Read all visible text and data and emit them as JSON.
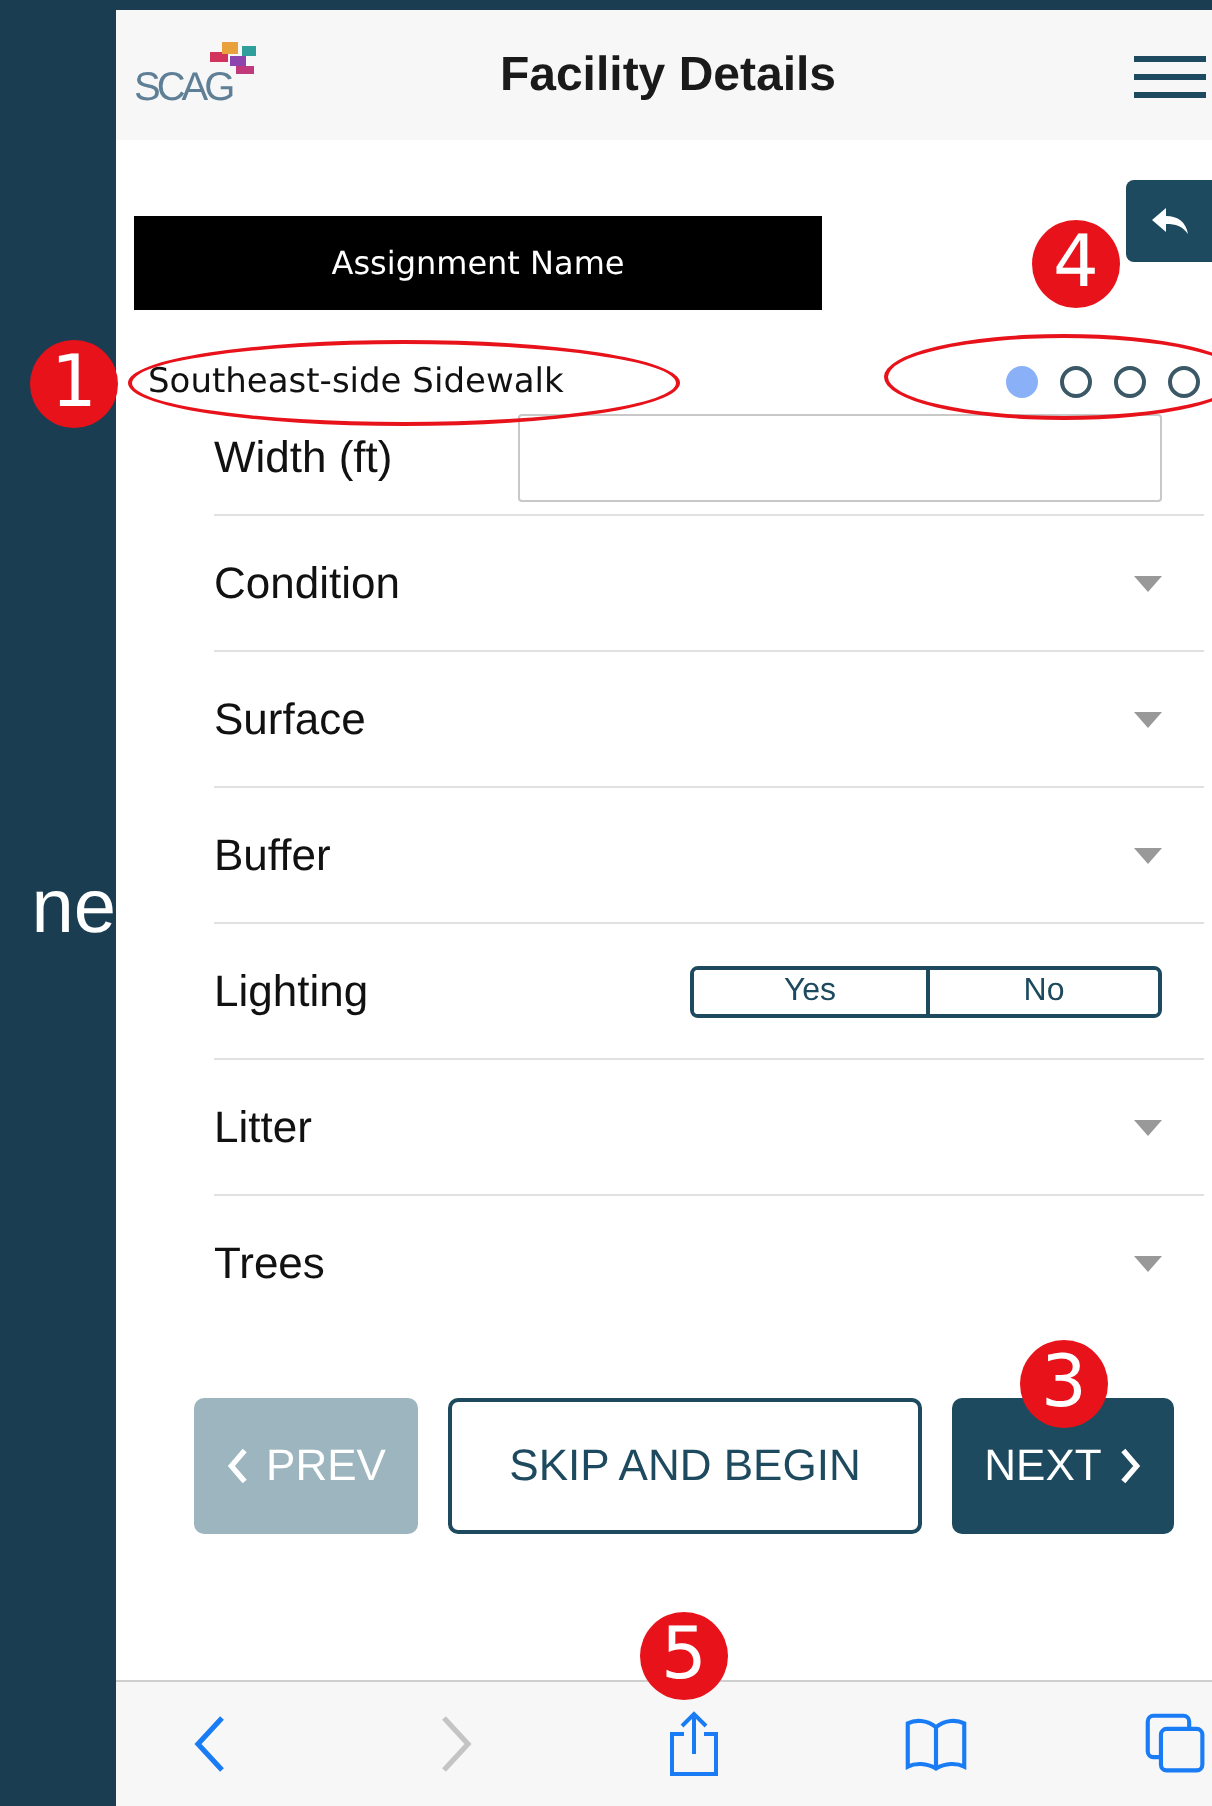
{
  "side_text": "ne",
  "header": {
    "logo": "SCAG",
    "title": "Facility Details"
  },
  "assignment_label": "Assignment Name",
  "facility_name": "Southeast-side Sidewalk",
  "page_dots": [
    {
      "selected": true
    },
    {
      "selected": false
    },
    {
      "selected": false
    },
    {
      "selected": false
    }
  ],
  "fields": [
    {
      "kind": "input",
      "label": "Width (ft)"
    },
    {
      "kind": "dropdown",
      "label": "Condition"
    },
    {
      "kind": "dropdown",
      "label": "Surface"
    },
    {
      "kind": "dropdown",
      "label": "Buffer"
    },
    {
      "kind": "toggle",
      "label": "Lighting",
      "options": [
        {
          "label": "Yes",
          "selected": false
        },
        {
          "label": "No",
          "selected": false
        }
      ]
    },
    {
      "kind": "dropdown",
      "label": "Litter"
    },
    {
      "kind": "dropdown",
      "label": "Trees"
    }
  ],
  "buttons": [
    {
      "kind": "prev",
      "label": "PREV",
      "disabled": true
    },
    {
      "kind": "skip",
      "label": "SKIP AND BEGIN"
    },
    {
      "kind": "next",
      "label": "NEXT"
    }
  ],
  "toolbar": [
    {
      "kind": "back",
      "disabled": false
    },
    {
      "kind": "forward",
      "disabled": true
    },
    {
      "kind": "share",
      "disabled": false
    },
    {
      "kind": "bookmarks",
      "disabled": false
    },
    {
      "kind": "tabs",
      "disabled": false
    }
  ],
  "annotations": [
    {
      "label": "1",
      "circled": true
    },
    {
      "label": "4",
      "circled": true
    },
    {
      "label": "3",
      "circled": false
    },
    {
      "label": "5",
      "circled": false
    }
  ]
}
